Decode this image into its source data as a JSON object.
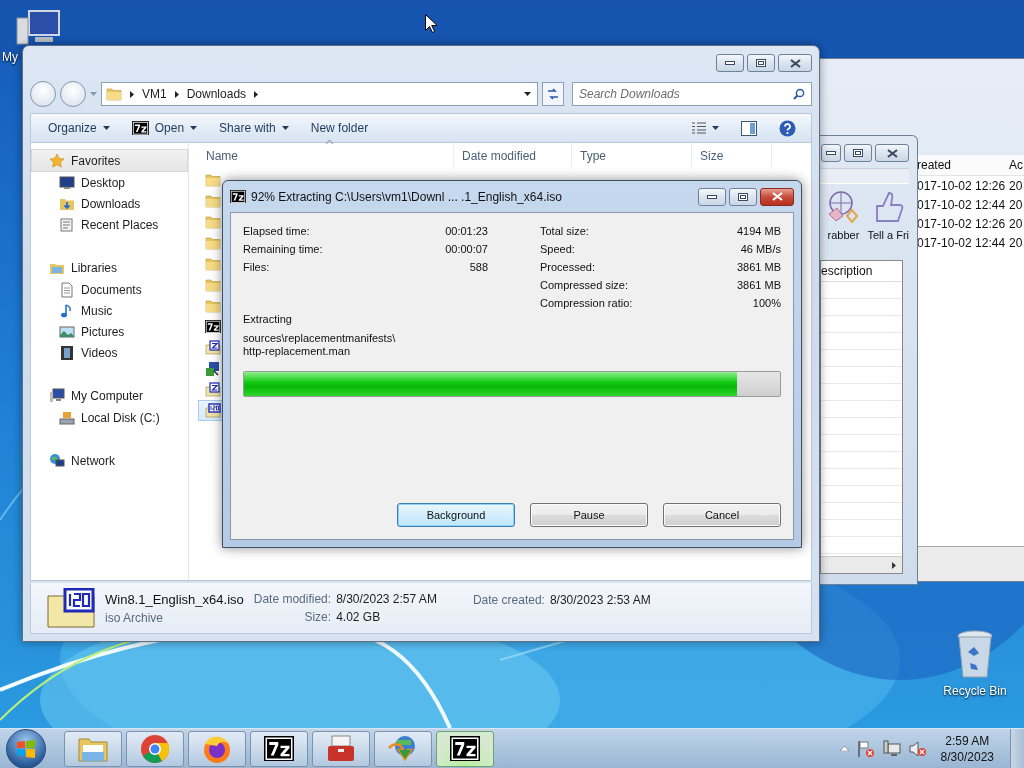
{
  "desktop": {
    "icons": [
      {
        "kind": "computer",
        "label": "My"
      },
      {
        "kind": "recycle",
        "label": "Recycle Bin"
      }
    ]
  },
  "back_window": {
    "columns": [
      "reated",
      "Ac"
    ],
    "rows": [
      [
        "017-10-02 12:26",
        "20"
      ],
      [
        "017-10-02 12:44",
        "20"
      ],
      [
        "017-10-02 12:26",
        "20"
      ],
      [
        "017-10-02 12:44",
        "20"
      ]
    ]
  },
  "middle_window": {
    "toolbar": [
      {
        "kind": "grabber",
        "label": "rabber"
      },
      {
        "kind": "like",
        "label": "Tell a Fri"
      }
    ],
    "list_header": "escription"
  },
  "explorer": {
    "active": false,
    "breadcrumb": [
      "VM1",
      "Downloads"
    ],
    "search_placeholder": "Search Downloads",
    "toolbar": [
      {
        "kind": "menu",
        "label": "Organize"
      },
      {
        "kind": "app_menu",
        "label": "Open"
      },
      {
        "kind": "menu",
        "label": "Share with"
      },
      {
        "kind": "action",
        "label": "New folder"
      }
    ],
    "nav": [
      {
        "kind": "favorites",
        "label": "Favorites",
        "selected": true,
        "children": [
          {
            "kind": "desktop",
            "label": "Desktop"
          },
          {
            "kind": "downloads",
            "label": "Downloads"
          },
          {
            "kind": "recent",
            "label": "Recent Places"
          }
        ]
      },
      {
        "kind": "libraries",
        "label": "Libraries",
        "selected": false,
        "children": [
          {
            "kind": "documents",
            "label": "Documents"
          },
          {
            "kind": "music",
            "label": "Music"
          },
          {
            "kind": "pictures",
            "label": "Pictures"
          },
          {
            "kind": "videos",
            "label": "Videos"
          }
        ]
      },
      {
        "kind": "computer",
        "label": "My Computer",
        "selected": false,
        "children": [
          {
            "kind": "disk",
            "label": "Local Disk (C:)"
          }
        ]
      },
      {
        "kind": "network",
        "label": "Network",
        "selected": false
      }
    ],
    "columns": [
      {
        "label": "Name",
        "sorted": true
      },
      {
        "label": "Date modified",
        "sorted": false
      },
      {
        "label": "Type",
        "sorted": false
      },
      {
        "label": "Size",
        "sorted": false
      }
    ],
    "files": [
      {
        "kind": "folder",
        "selected": false
      },
      {
        "kind": "folder",
        "selected": false
      },
      {
        "kind": "folder",
        "selected": false
      },
      {
        "kind": "folder",
        "selected": false
      },
      {
        "kind": "folder",
        "selected": false
      },
      {
        "kind": "folder",
        "selected": false
      },
      {
        "kind": "folder",
        "selected": false
      },
      {
        "kind": "sevenzip",
        "selected": false
      },
      {
        "kind": "zip",
        "selected": false
      },
      {
        "kind": "exe",
        "selected": false
      },
      {
        "kind": "zip",
        "selected": false
      },
      {
        "kind": "iso",
        "selected": true
      }
    ],
    "details": {
      "name": "Win8.1_English_x64.iso",
      "type": "iso Archive",
      "fields": [
        {
          "label": "Date modified:",
          "value": "8/30/2023 2:57 AM"
        },
        {
          "label": "Size:",
          "value": "4.02 GB"
        },
        {
          "label": "Date created:",
          "value": "8/30/2023 2:53 AM"
        }
      ]
    }
  },
  "extract_dialog": {
    "active": true,
    "title": "92% Extracting C:\\Users\\vm1\\Downl ... .1_English_x64.iso",
    "stats_left": [
      {
        "label": "Elapsed time:",
        "value": "00:01:23"
      },
      {
        "label": "Remaining time:",
        "value": "00:00:07"
      },
      {
        "label": "Files:",
        "value": "588"
      }
    ],
    "stats_right": [
      {
        "label": "Total size:",
        "value": "4194 MB"
      },
      {
        "label": "Speed:",
        "value": "46 MB/s"
      },
      {
        "label": "Processed:",
        "value": "3861 MB"
      },
      {
        "label": "Compressed size:",
        "value": "3861 MB"
      },
      {
        "label": "Compression ratio:",
        "value": "100%"
      }
    ],
    "status_label": "Extracting",
    "current_path": [
      "sources\\replacementmanifests\\",
      "http-replacement.man"
    ],
    "progress": {
      "level": 0.92
    },
    "buttons": [
      {
        "label": "Background",
        "default": true
      },
      {
        "label": "Pause",
        "default": false
      },
      {
        "label": "Cancel",
        "default": false
      }
    ]
  },
  "taskbar": {
    "items": [
      {
        "kind": "explorer",
        "active": false
      },
      {
        "kind": "chrome",
        "active": false
      },
      {
        "kind": "firefox",
        "active": false
      },
      {
        "kind": "sevenzip",
        "active": false
      },
      {
        "kind": "toolbox",
        "active": false
      },
      {
        "kind": "download",
        "active": false
      },
      {
        "kind": "sevenzip",
        "active": true
      }
    ],
    "time": "2:59 AM",
    "date": "8/30/2023"
  }
}
